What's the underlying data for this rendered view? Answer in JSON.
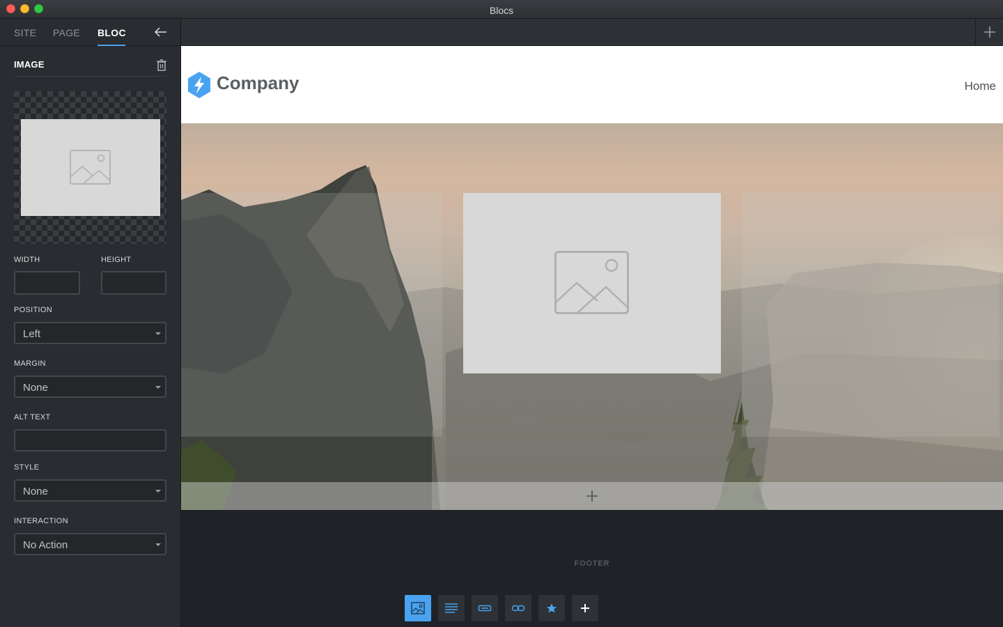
{
  "window": {
    "title": "Blocs"
  },
  "sidebar": {
    "tabs": [
      "SITE",
      "PAGE",
      "BLOC"
    ],
    "section_title": "IMAGE",
    "fields": {
      "width_label": "WIDTH",
      "height_label": "HEIGHT",
      "width_value": "",
      "height_value": "",
      "position_label": "POSITION",
      "position_value": "Left",
      "margin_label": "MARGIN",
      "margin_value": "None",
      "alt_label": "ALT TEXT",
      "alt_value": "",
      "style_label": "STYLE",
      "style_value": "None",
      "interaction_label": "INTERACTION",
      "interaction_value": "No Action"
    }
  },
  "canvas": {
    "navbar": {
      "brand": "Company",
      "nav_link": "Home"
    },
    "footer_label": "FOOTER",
    "bottom_tools": [
      "image-icon",
      "text-icon",
      "button-icon",
      "link-icon",
      "star-icon",
      "plus-icon"
    ]
  },
  "colors": {
    "accent": "#4aa3f0",
    "sidebar_bg": "#292c30",
    "canvas_bg": "#1f2226"
  }
}
